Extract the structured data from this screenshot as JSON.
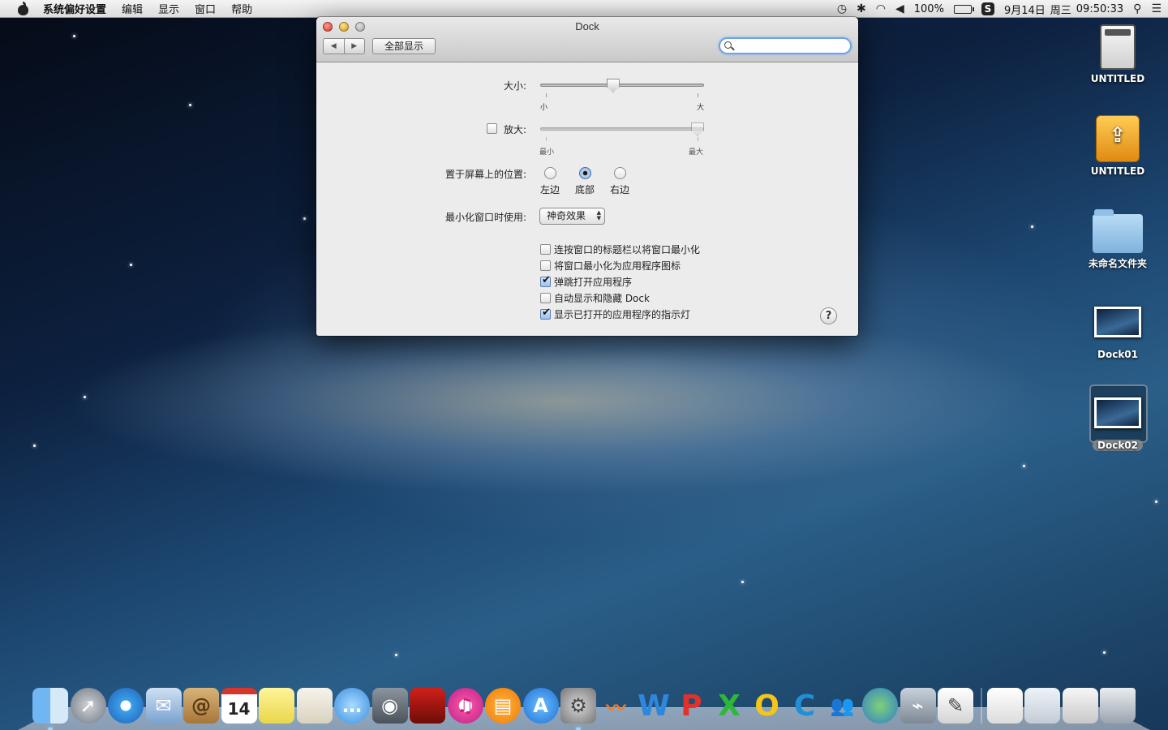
{
  "menubar": {
    "app_name": "系统偏好设置",
    "items": [
      "编辑",
      "显示",
      "窗口",
      "帮助"
    ],
    "battery": "100%",
    "date": "9月14日",
    "weekday": "周三",
    "time": "09:50:33"
  },
  "window": {
    "title": "Dock",
    "show_all": "全部显示",
    "search_placeholder": "",
    "size_label": "大小:",
    "size_min": "小",
    "size_max": "大",
    "size_value": 0.44,
    "magnify_label": "放大:",
    "magnify_checked": false,
    "magnify_min": "最小",
    "magnify_max": "最大",
    "magnify_value": 1.0,
    "position_label": "置于屏幕上的位置:",
    "position_options": [
      "左边",
      "底部",
      "右边"
    ],
    "position_selected": "底部",
    "minimize_label": "最小化窗口时使用:",
    "minimize_effect": "神奇效果",
    "options": [
      {
        "label": "连按窗口的标题栏以将窗口最小化",
        "checked": false
      },
      {
        "label": "将窗口最小化为应用程序图标",
        "checked": false
      },
      {
        "label": "弹跳打开应用程序",
        "checked": true
      },
      {
        "label": "自动显示和隐藏 Dock",
        "checked": false
      },
      {
        "label": "显示已打开的应用程序的指示灯",
        "checked": true
      }
    ],
    "help": "?"
  },
  "desktop": {
    "icons": [
      {
        "label": "UNTITLED",
        "icon": "disk-image-icon"
      },
      {
        "label": "UNTITLED",
        "icon": "usb-drive-icon"
      },
      {
        "label": "未命名文件夹",
        "icon": "folder-icon"
      },
      {
        "label": "Dock01",
        "icon": "screenshot-icon"
      },
      {
        "label": "Dock02",
        "icon": "screenshot-icon",
        "selected": true
      }
    ]
  },
  "dock": {
    "calendar_day": "14",
    "word_letter": "W",
    "ppt_letter": "P",
    "excel_letter": "X",
    "outlook_letter": "O",
    "lync_letter": "C"
  }
}
